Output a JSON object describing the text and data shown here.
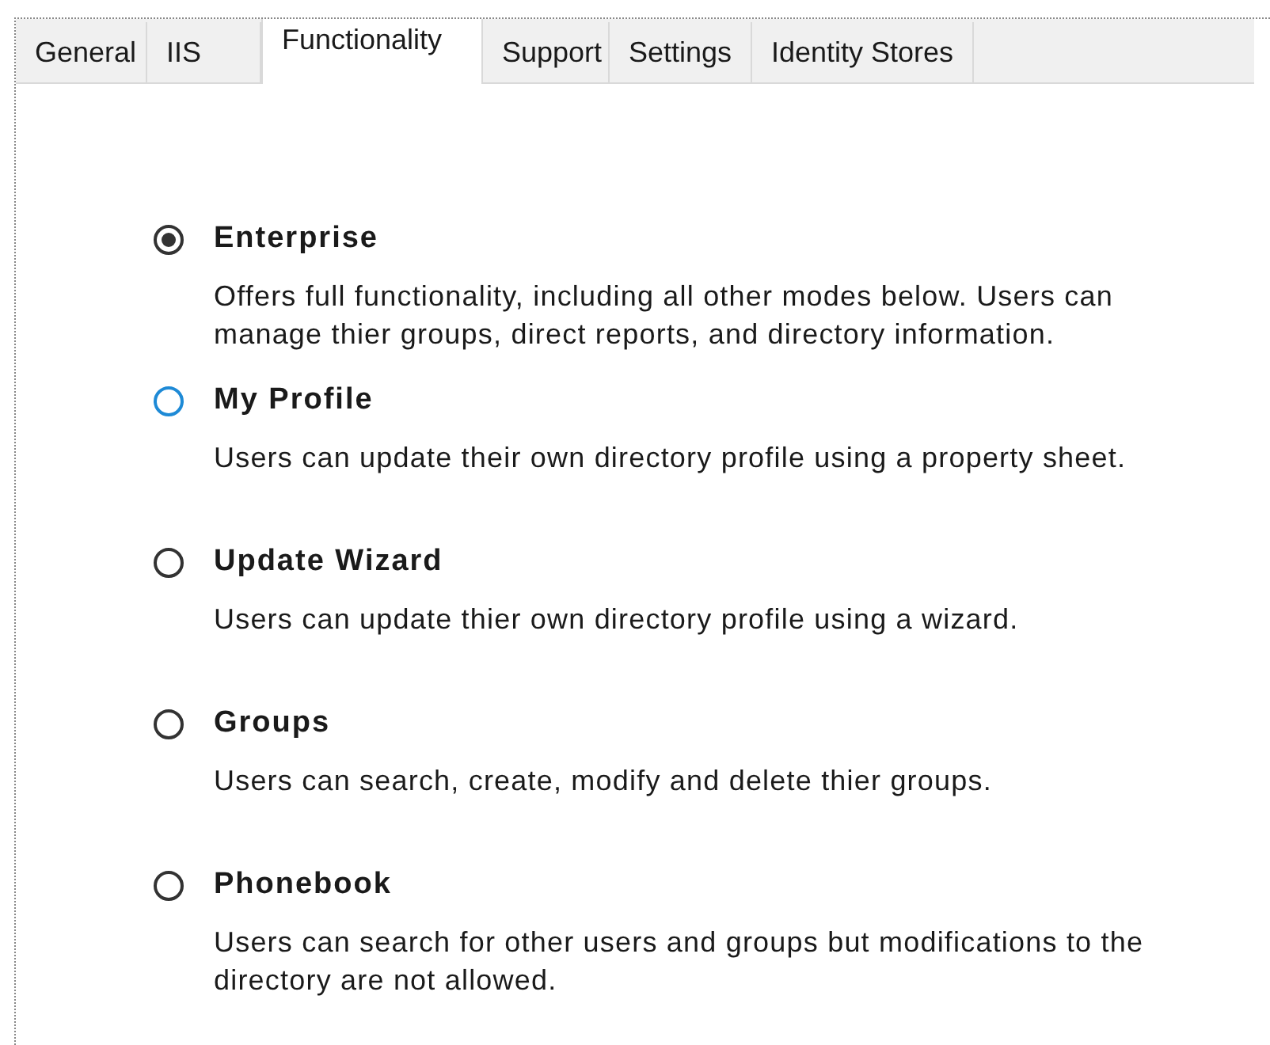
{
  "tabs": [
    {
      "label": "General",
      "selected": false
    },
    {
      "label": "IIS",
      "selected": false
    },
    {
      "label": "Functionality",
      "selected": true
    },
    {
      "label": "Support",
      "selected": false
    },
    {
      "label": "Settings",
      "selected": false
    },
    {
      "label": "Identity Stores",
      "selected": false
    }
  ],
  "options": [
    {
      "label": "Enterprise",
      "description": "Offers full functionality, including all other modes below.  Users can manage thier groups, direct reports, and directory information.",
      "selected": true,
      "hovered": false
    },
    {
      "label": "My Profile",
      "description": "Users can update their own directory profile using a property sheet.",
      "selected": false,
      "hovered": true
    },
    {
      "label": "Update Wizard",
      "description": "Users can update thier own directory profile using a wizard.",
      "selected": false,
      "hovered": false
    },
    {
      "label": "Groups",
      "description": "Users can search, create, modify and delete thier groups.",
      "selected": false,
      "hovered": false
    },
    {
      "label": "Phonebook",
      "description": "Users can search for other users and groups but modifications to the directory are not allowed.",
      "selected": false,
      "hovered": false
    }
  ]
}
